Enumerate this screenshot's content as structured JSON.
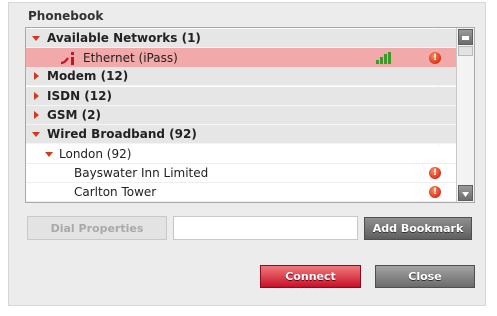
{
  "phonebook": {
    "title": "Phonebook",
    "rows": [
      {
        "label": "Available Networks (1)",
        "kind": "group",
        "expanded": true
      },
      {
        "label": "Ethernet (iPass)",
        "kind": "connection",
        "selected": true,
        "signal_icon": "signal-bars-icon",
        "status_icon": "error-icon"
      },
      {
        "label": "Modem (12)",
        "kind": "group",
        "expanded": false
      },
      {
        "label": "ISDN (12)",
        "kind": "group",
        "expanded": false
      },
      {
        "label": "GSM (2)",
        "kind": "group",
        "expanded": false
      },
      {
        "label": "Wired Broadband (92)",
        "kind": "group",
        "expanded": true
      },
      {
        "label": "London (92)",
        "kind": "subgroup",
        "expanded": true
      },
      {
        "label": "Bayswater Inn Limited",
        "kind": "location",
        "status_icon": "error-icon"
      },
      {
        "label": "Carlton Tower",
        "kind": "location",
        "status_icon": "error-icon"
      }
    ],
    "error_glyph": "!"
  },
  "buttons": {
    "dial_properties": "Dial Properties",
    "add_bookmark": "Add Bookmark",
    "connect": "Connect",
    "close": "Close"
  },
  "colors": {
    "selection": "#f2a9a9",
    "accent_red": "#c8102a",
    "signal_green": "#3d9a2a",
    "arrow": "#d43a1a"
  }
}
